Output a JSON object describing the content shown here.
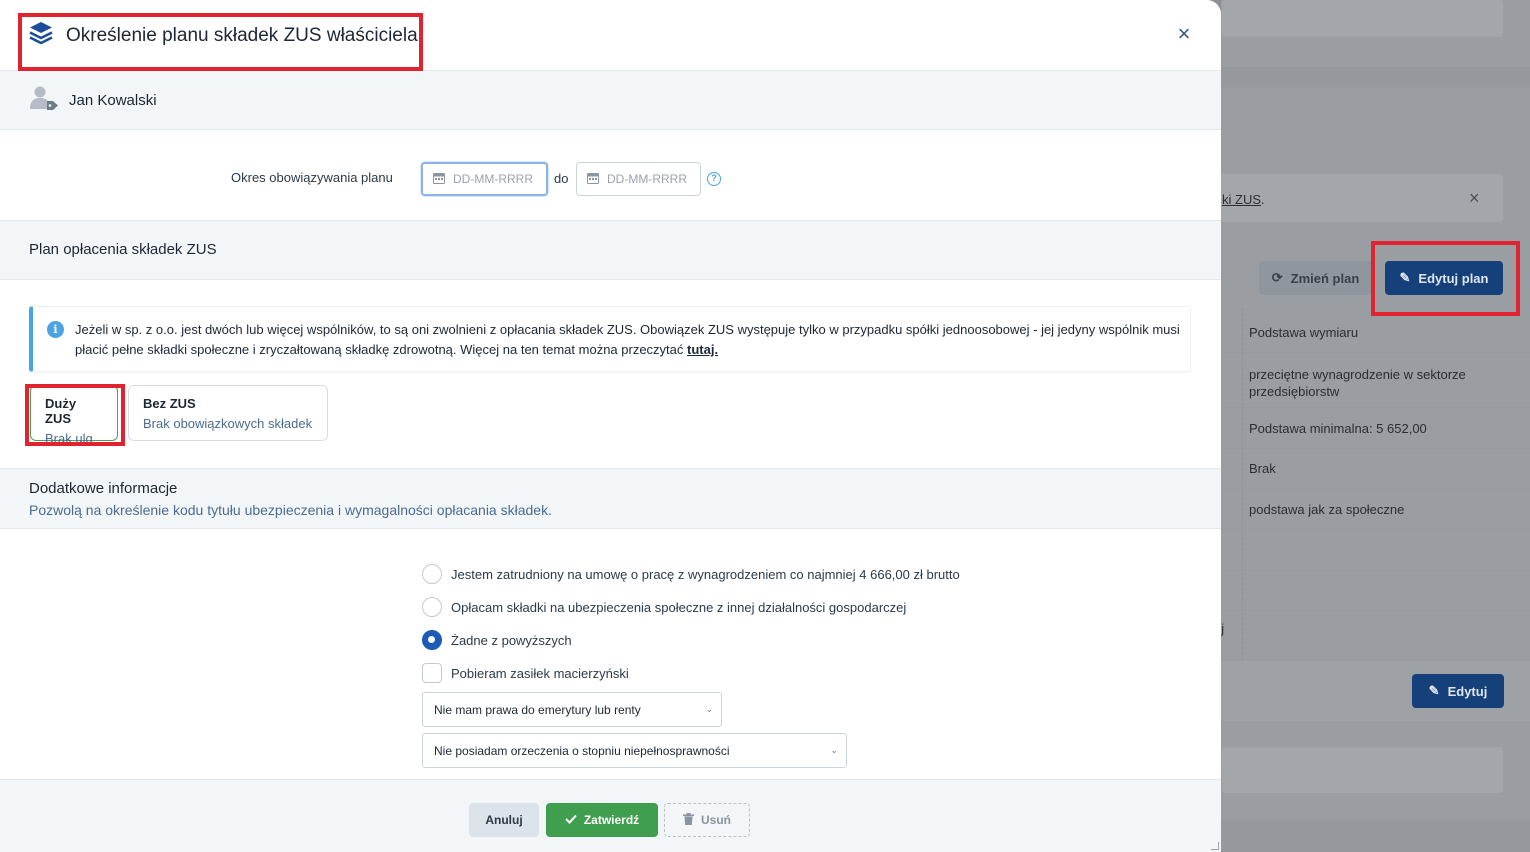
{
  "modal": {
    "title": "Określenie planu składek ZUS właściciela",
    "close_label": "×",
    "user_name": "Jan Kowalski",
    "period": {
      "label": "Okres obowiązywania planu",
      "from_placeholder": "DD-MM-RRRR",
      "separator": "do",
      "to_placeholder": "DD-MM-RRRR"
    },
    "plan_section": {
      "title": "Plan opłacenia składek ZUS",
      "info_text": "Jeżeli w sp. z o.o. jest dwóch lub więcej wspólników, to są oni zwolnieni z opłacania składek ZUS. Obowiązek ZUS występuje tylko w przypadku spółki jednoosobowej - jej jedyny wspólnik musi płacić pełne składki społeczne i zryczałtowaną składkę zdrowotną. Więcej na ten temat można przeczytać",
      "info_link": "tutaj.",
      "plans": [
        {
          "name": "Duży ZUS",
          "desc": "Brak ulg",
          "selected": true
        },
        {
          "name": "Bez ZUS",
          "desc": "Brak obowiązkowych składek",
          "selected": false
        }
      ]
    },
    "additional": {
      "title": "Dodatkowe informacje",
      "subtitle": "Pozwolą na określenie kodu tytułu ubezpieczenia i wymagalności opłacania składek.",
      "options": [
        {
          "label": "Jestem zatrudniony na umowę o pracę z wynagrodzeniem co najmniej 4 666,00 zł brutto",
          "checked": false
        },
        {
          "label": "Opłacam składki na ubezpieczenia społeczne z innej działalności gospodarczej",
          "checked": false
        },
        {
          "label": "Żadne z powyższych",
          "checked": true
        }
      ],
      "checkbox_label": "Pobieram zasiłek macierzyński",
      "pension_select": "Nie mam prawa do emerytury lub renty",
      "disability_select": "Nie posiadam orzeczenia o stopniu niepełnosprawności"
    },
    "footer": {
      "cancel": "Anuluj",
      "confirm": "Zatwierdź",
      "delete": "Usuń"
    }
  },
  "background": {
    "notice_link": "ki ZUS",
    "notice_suffix": ".",
    "notice_close": "×",
    "change_plan": "Zmień plan",
    "edit_plan": "Edytuj plan",
    "table_header": "Podstawa wymiaru",
    "rows": [
      "przeciętne wynagrodzenie w sektorze przedsiębiorstw",
      "Podstawa minimalna: 5 652,00",
      "Brak",
      "podstawa jak za społeczne",
      "",
      ""
    ],
    "row_fragment": "ej",
    "edit_button": "Edytuj"
  },
  "colors": {
    "primary": "#1c5bb8",
    "success": "#3f9f4f",
    "info": "#4ba3e3",
    "highlight": "#e0232e"
  }
}
